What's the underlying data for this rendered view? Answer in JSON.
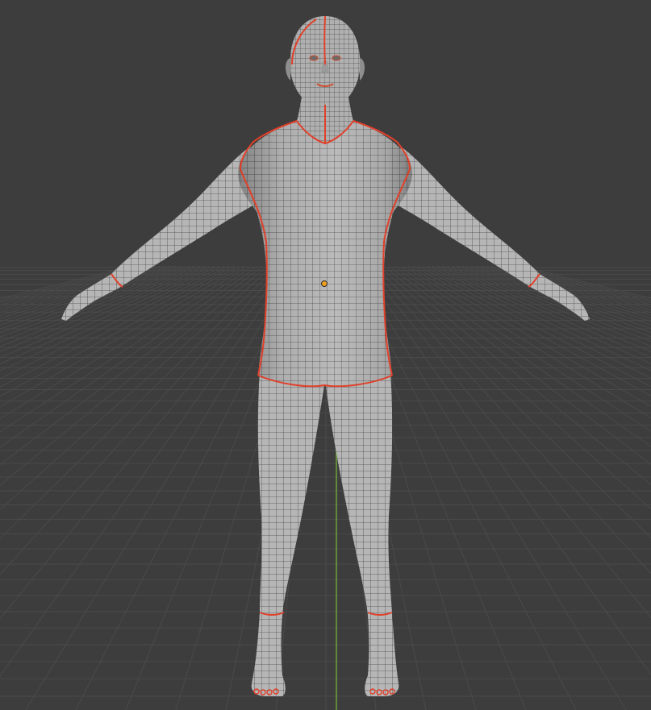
{
  "viewport": {
    "background": "#3d3d3d",
    "grid_color": "#4a4a4a",
    "axis_y_color": "#6a9e3a",
    "axis_x_color": "#8a3a3a"
  },
  "model": {
    "object": "human-base-mesh",
    "mode": "object",
    "surface_color": "#b4b4b4",
    "wire_color": "#4b4b4b",
    "seam_color": "#e0402a",
    "origin_color": "#f0a020"
  }
}
